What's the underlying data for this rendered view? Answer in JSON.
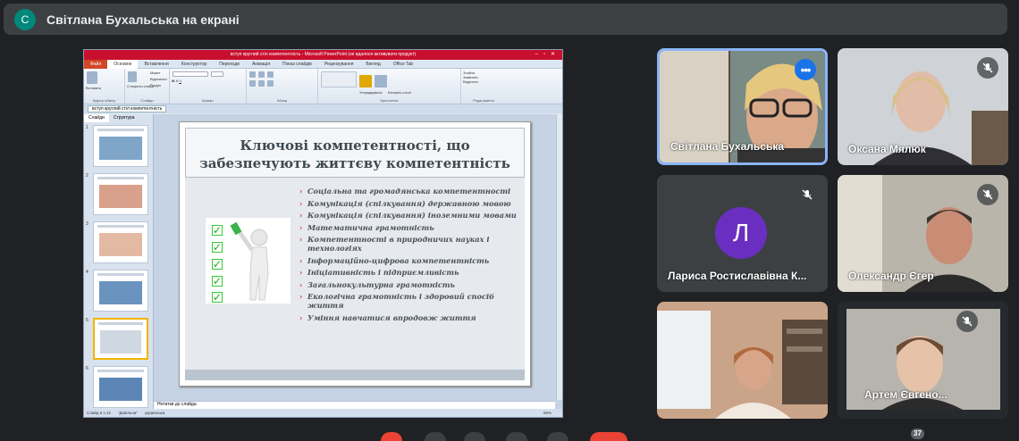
{
  "presenter": {
    "initial": "С",
    "banner": "Світлана Бухальська на екрані"
  },
  "powerpoint": {
    "window_title": "вступ круглий стіл  компетентність  -  Microsoft PowerPoint (не вдалося активувати продукт)",
    "tabs": [
      "Файл",
      "Основне",
      "Вставлення",
      "Конструктор",
      "Переходи",
      "Анімація",
      "Показ слайдів",
      "Рецензування",
      "Вигляд",
      "Office Tab"
    ],
    "ribbon_groups": [
      "Буфер обміну",
      "Слайди",
      "Шрифт",
      "Абзац",
      "Креслення",
      "Редагування"
    ],
    "ribbon_buttons": {
      "paste": "Вставити",
      "new_slide": "Створити слайд",
      "layout": "Макет",
      "reset": "Відновити",
      "section": "Розділ",
      "arrange": "Упорядкувати",
      "quick_styles": "Експрес-стилі",
      "find": "Знайти",
      "replace": "Замінити",
      "select": "Виділити"
    },
    "doc_tab": "вступ круглий стіл  компетентність",
    "panel_tabs": [
      "Слайди",
      "Структура"
    ],
    "slide_numbers": [
      "1",
      "2",
      "3",
      "4",
      "5",
      "6"
    ],
    "slide": {
      "title": "Ключові компетентності, що забезпечують життєву  компетентність",
      "bullets": [
        "Соціальна та громадянська компетентності",
        "Комунікація (спілкування) державною мовою",
        "  Комунікація (спілкування)  іноземними мовами",
        "Математична грамотність",
        "Компетентності в природничих науках і технологіях",
        "Інформаційно-цифрова компетентність",
        "Ініціативність і підприємливість",
        "Загальнокультурна грамотність",
        "Екологічна грамотність і здоровий спосіб життя",
        "Уміння навчатися впродовж життя"
      ]
    },
    "notes": "Нотатки до слайда",
    "status": {
      "slide": "Слайд 5 з 12",
      "theme": "\"Довільна\"",
      "lang": "українська",
      "zoom": "55%"
    }
  },
  "participants": [
    {
      "name": "Світлана Бухальська",
      "muted": false,
      "highlight": true
    },
    {
      "name": "Оксана Мялюк",
      "muted": true
    },
    {
      "name": "Лариса Ростиславівна К...",
      "muted": true,
      "initial": "Л",
      "avatar_color": "#6a2fc0"
    },
    {
      "name": "Олександр Єгер",
      "muted": true
    },
    {
      "name": "",
      "muted": false
    },
    {
      "name": "Артем Євгено...",
      "muted": true
    }
  ],
  "participant_count": "37",
  "colors": {
    "background": "#202124",
    "tile": "#3c4043",
    "highlight": "#8ab4f8",
    "accent": "#1a73e8",
    "leave": "#ea4335"
  }
}
